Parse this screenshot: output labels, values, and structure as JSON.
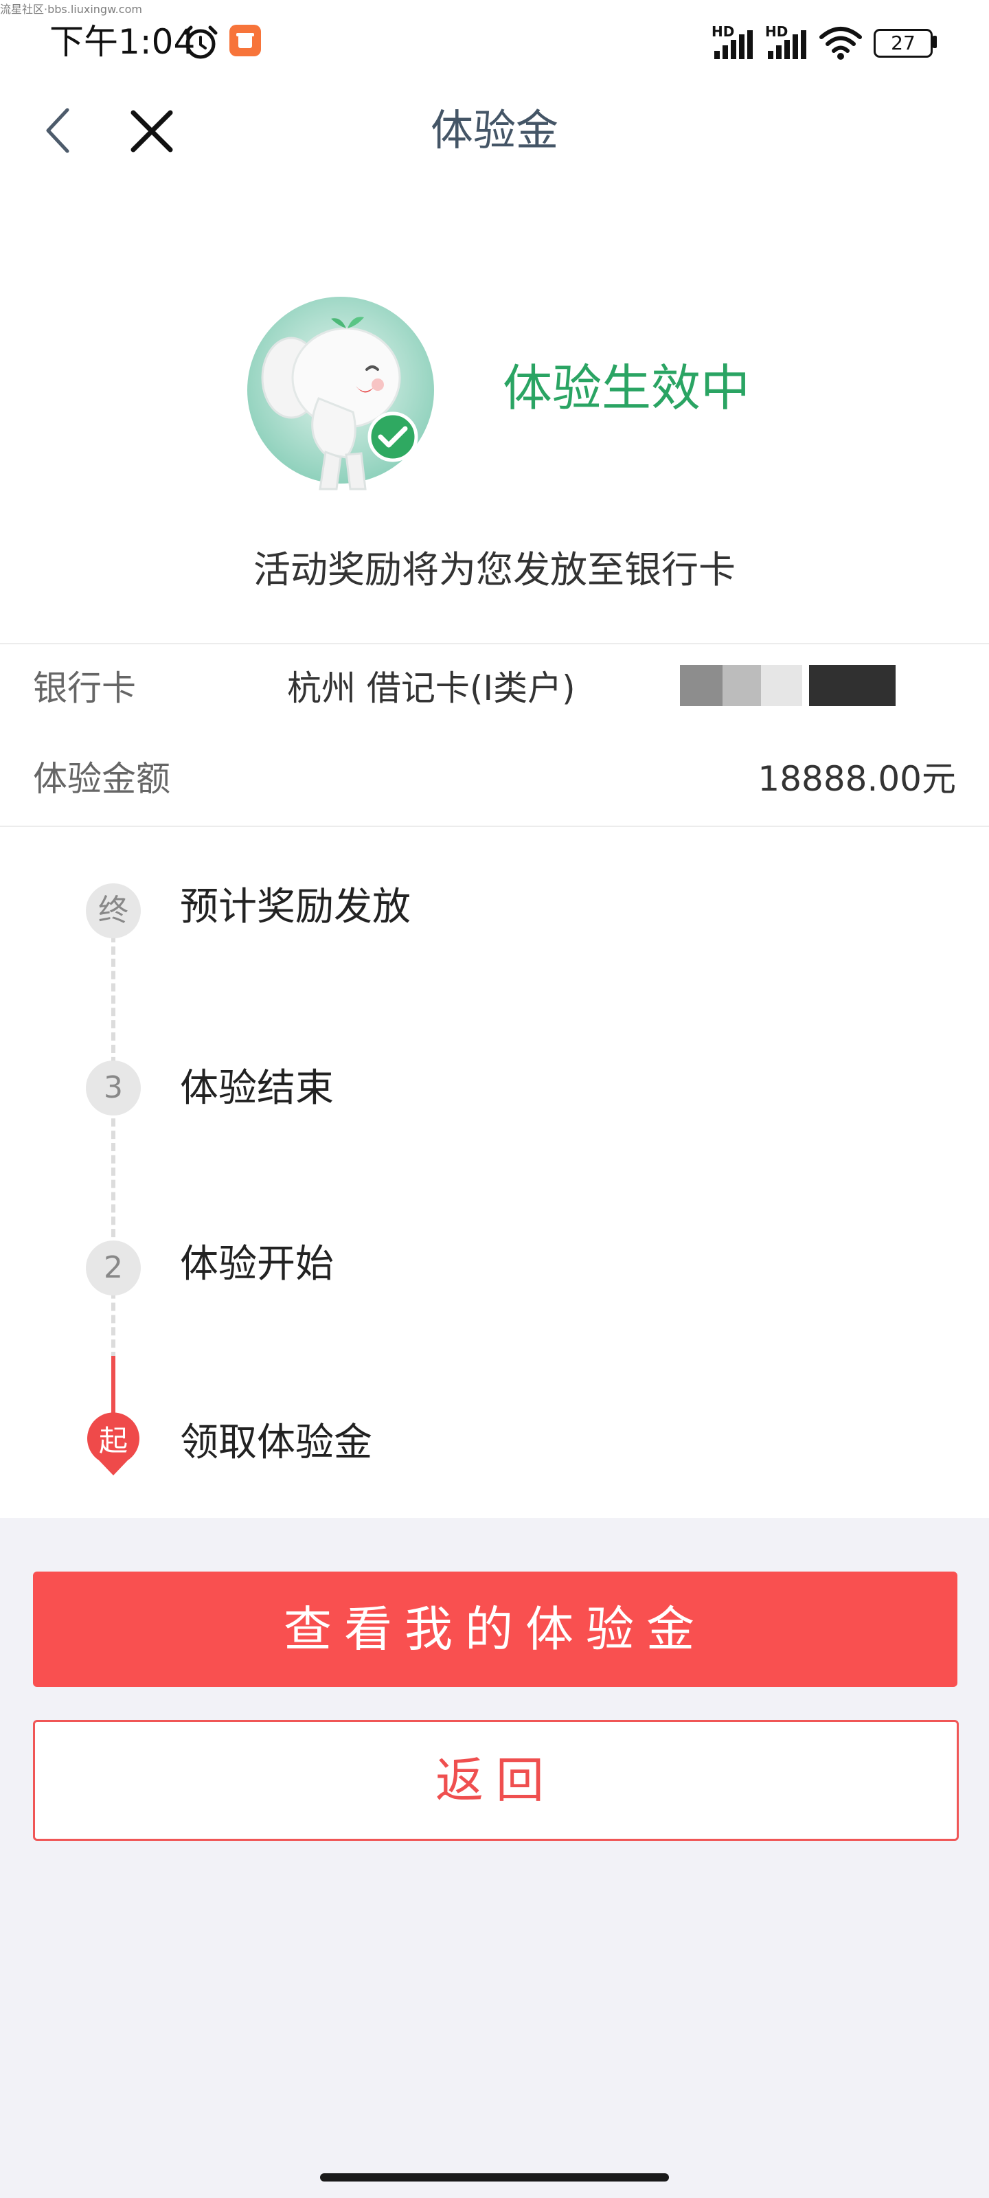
{
  "watermark": "流星社区·bbs.liuxingw.com",
  "status_bar": {
    "time": "下午1:04",
    "battery": "27",
    "signal_label_1": "HD",
    "signal_label_2": "HD"
  },
  "nav": {
    "title": "体验金"
  },
  "hero": {
    "status_title": "体验生效中",
    "subtitle": "活动奖励将为您发放至银行卡"
  },
  "info": {
    "bank_card_label": "银行卡",
    "bank_card_value": "杭州 借记卡(I类户)",
    "amount_label": "体验金额",
    "amount_value": "18888.00元"
  },
  "timeline": [
    {
      "marker": "终",
      "label": "预计奖励发放"
    },
    {
      "marker": "3",
      "label": "体验结束"
    },
    {
      "marker": "2",
      "label": "体验开始"
    },
    {
      "marker": "起",
      "label": "领取体验金"
    }
  ],
  "buttons": {
    "primary": "查看我的体验金",
    "secondary": "返回"
  },
  "colors": {
    "accent_red": "#f95050",
    "status_green": "#2aa463"
  }
}
